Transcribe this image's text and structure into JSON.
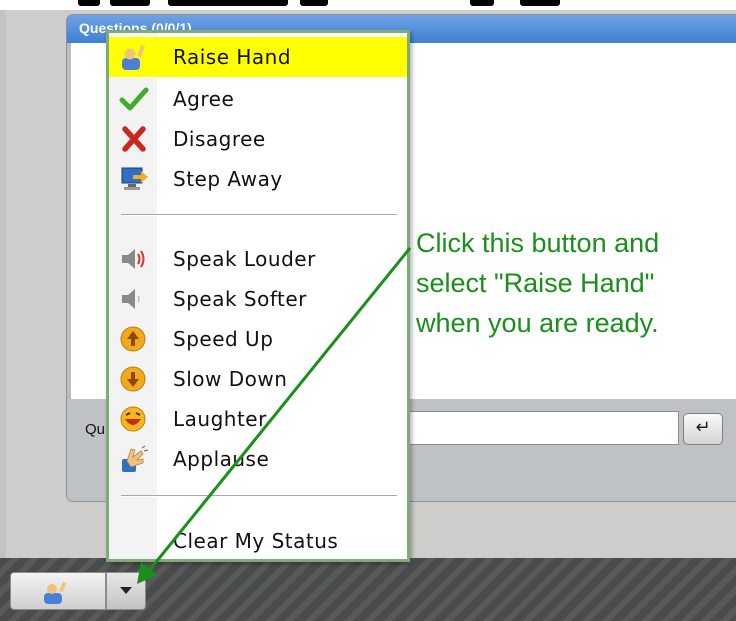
{
  "pod": {
    "title": "Questions (0/0/1)",
    "question_label": "Qu",
    "send_icon": "return-arrow-icon"
  },
  "menu": {
    "items_group1": [
      {
        "label": "Raise Hand",
        "icon": "raise-hand-icon",
        "selected": true
      },
      {
        "label": "Agree",
        "icon": "checkmark-icon",
        "selected": false
      },
      {
        "label": "Disagree",
        "icon": "red-x-icon",
        "selected": false
      },
      {
        "label": "Step Away",
        "icon": "step-away-icon",
        "selected": false
      }
    ],
    "items_group2": [
      {
        "label": "Speak Louder",
        "icon": "speaker-loud-icon"
      },
      {
        "label": "Speak Softer",
        "icon": "speaker-soft-icon"
      },
      {
        "label": "Speed Up",
        "icon": "speed-up-icon"
      },
      {
        "label": "Slow Down",
        "icon": "slow-down-icon"
      },
      {
        "label": "Laughter",
        "icon": "laughing-face-icon"
      },
      {
        "label": "Applause",
        "icon": "applause-icon"
      }
    ],
    "clear_label": "Clear My Status"
  },
  "toolbar": {
    "status_icon": "raise-hand-icon",
    "dropdown_icon": "chevron-down-icon"
  },
  "annotation": {
    "line1": "Click this button and",
    "line2": "select \"Raise Hand\"",
    "line3": "when you are ready."
  },
  "colors": {
    "annotation_green": "#1a8f1a",
    "selected_highlight": "#ffff00",
    "menu_border": "#7faa7a"
  }
}
